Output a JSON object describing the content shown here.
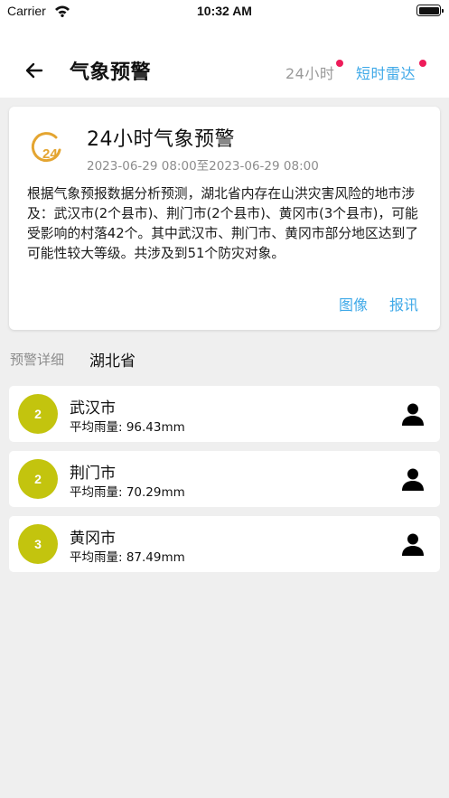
{
  "status_bar": {
    "carrier": "Carrier",
    "time": "10:32 AM"
  },
  "nav": {
    "title": "气象预警",
    "tab_24h": "24小时",
    "tab_radar": "短时雷达"
  },
  "warning": {
    "title": "24小时气象预警",
    "time_range": "2023-06-29 08:00至2023-06-29 08:00",
    "icon_text": "24",
    "description": "根据气象预报数据分析预测，湖北省内存在山洪灾害风险的地市涉及：武汉市(2个县市)、荆门市(2个县市)、黄冈市(3个县市)，可能受影响的村落42个。其中武汉市、荆门市、黄冈市部分地区达到了可能性较大等级。共涉及到51个防灾对象。",
    "link_image": "图像",
    "link_report": "报讯"
  },
  "detail": {
    "label": "预警详细",
    "province": "湖北省"
  },
  "cities": [
    {
      "count": "2",
      "name": "武汉市",
      "rain": "平均雨量: 96.43mm"
    },
    {
      "count": "2",
      "name": "荆门市",
      "rain": "平均雨量: 70.29mm"
    },
    {
      "count": "3",
      "name": "黄冈市",
      "rain": "平均雨量: 87.49mm"
    }
  ],
  "colors": {
    "accent": "#3fa9e8",
    "badge": "#c3c40e",
    "dot": "#ee1c5a",
    "icon": "#e4a531"
  }
}
